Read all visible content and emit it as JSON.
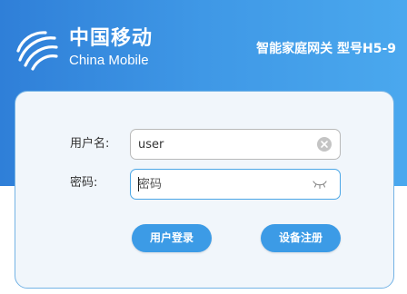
{
  "brand": {
    "name_cn": "中国移动",
    "name_en": "China Mobile"
  },
  "header": {
    "gateway_title": "智能家庭网关  型号H5-9"
  },
  "form": {
    "username_label": "用户名:",
    "username_value": "user",
    "password_label": "密码:",
    "password_placeholder": "密码"
  },
  "buttons": {
    "login": "用户登录",
    "register": "设备注册"
  },
  "colors": {
    "header_blue": "#3f98e6",
    "button_blue": "#3c9be6",
    "card_border": "#74b3e5"
  },
  "icons": {
    "logo": "china-mobile-logo",
    "clear": "clear-icon",
    "password_toggle": "eye-closed-icon"
  }
}
